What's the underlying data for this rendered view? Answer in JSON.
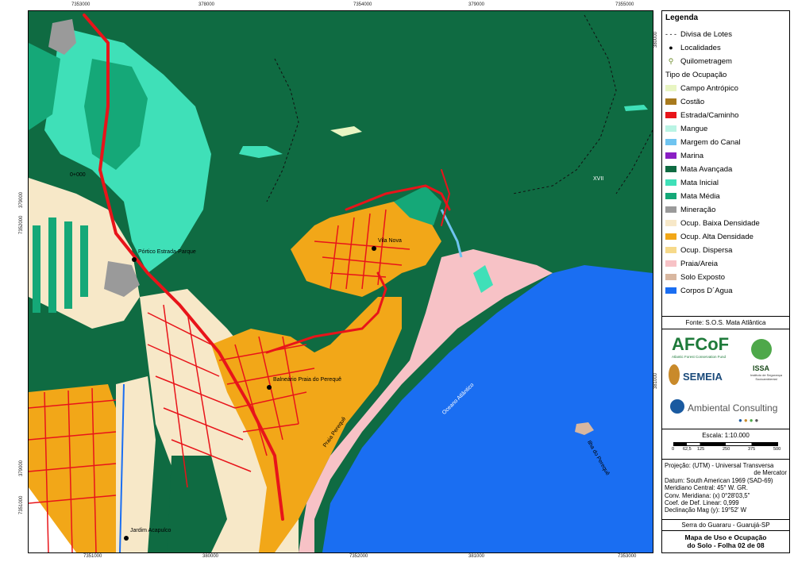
{
  "ticks": {
    "top": [
      "7353000",
      "378000",
      "7354000",
      "379000",
      "7355000"
    ],
    "bottom": [
      "7351000",
      "380000",
      "7352000",
      "381000",
      "7353000"
    ],
    "left": [
      "379000",
      "7352000",
      "379000",
      "7351000"
    ],
    "right": [
      "380000",
      "381000"
    ]
  },
  "map_labels": {
    "portico": "Pórtico Estrada-Parque",
    "vila_nova": "Vila Nova",
    "balneario": "Balneário Praia do Perequê",
    "jardim": "Jardim Acapulco",
    "praia": "Praia Perequê",
    "oceano": "Oceano Atlântico",
    "ilha": "Ilha do Perequê",
    "km": "0+000",
    "zone": "XVII"
  },
  "legend": {
    "title": "Legenda",
    "lines": [
      {
        "label": "Divisa de Lotes",
        "icon": "dashed-line-icon"
      },
      {
        "label": "Localidades",
        "icon": "dot-icon"
      },
      {
        "label": "Quilometragem",
        "icon": "km-marker-icon"
      }
    ],
    "group_title": "Tipo de Ocupação",
    "items": [
      {
        "label": "Campo Antrópico",
        "color": "#e8f5c2"
      },
      {
        "label": "Costão",
        "color": "#a87a1e"
      },
      {
        "label": "Estrada/Caminho",
        "color": "#e8141a"
      },
      {
        "label": "Mangue",
        "color": "#b9f4e4"
      },
      {
        "label": "Margem do Canal",
        "color": "#6fc4f0"
      },
      {
        "label": "Marina",
        "color": "#8a1fc4"
      },
      {
        "label": "Mata Avançada",
        "color": "#0f6b42"
      },
      {
        "label": "Mata Inicial",
        "color": "#3fe0b8"
      },
      {
        "label": "Mata Média",
        "color": "#15a878"
      },
      {
        "label": "Mineração",
        "color": "#9a9a9a"
      },
      {
        "label": "Ocup. Baixa Densidade",
        "color": "#f7e8c8"
      },
      {
        "label": "Ocup. Alta Densidade",
        "color": "#f2a718"
      },
      {
        "label": "Ocup. Dispersa",
        "color": "#f6d98a"
      },
      {
        "label": "Praia/Areia",
        "color": "#f7c2c6"
      },
      {
        "label": "Solo Exposto",
        "color": "#d8b7a0"
      },
      {
        "label": "Corpos D´Agua",
        "color": "#1a6ef2"
      }
    ]
  },
  "source": "Fonte: S.O.S. Mata Atlântica",
  "logos": {
    "afcof": "AFCoF",
    "afcof_sub": "Atlantic Forest Conservation Fund",
    "semeia": "SEMEIA",
    "issa": "ISSA",
    "issa_sub": "Instituto de Segurança Socioambiental",
    "ambiental": "Ambiental Consulting"
  },
  "scale": {
    "title": "Escala: 1:10.000",
    "ticks": [
      "0",
      "62,5",
      "125",
      "250",
      "375",
      "500"
    ]
  },
  "projection": [
    "Projeção: (UTM) - Universal Transversa",
    "de Mercator",
    "Datum: South American 1969 (SAD-69)",
    "Meridiano Central: 45° W. GR.",
    "Conv. Meridiana: (x) 0°28'03,5\"",
    "Coef. de Def. Linear: 0,999",
    "Declinação Mag (y): 19°52' W"
  ],
  "place": "Serra do Guararu - Guarujá-SP",
  "map_title": [
    "Mapa de Uso e Ocupação",
    "do Solo - Folha 02 de 08"
  ]
}
